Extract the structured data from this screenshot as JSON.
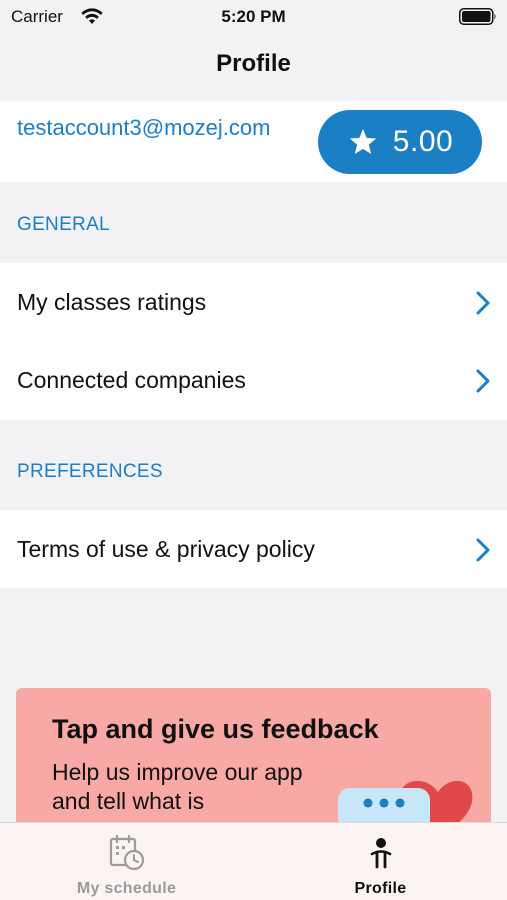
{
  "status_bar": {
    "carrier": "Carrier",
    "time": "5:20 PM"
  },
  "nav": {
    "title": "Profile"
  },
  "account": {
    "email": "testaccount3@mozej.com",
    "rating": "5.00"
  },
  "sections": {
    "general": {
      "header": "GENERAL",
      "items": [
        {
          "label": "My classes ratings"
        },
        {
          "label": "Connected companies"
        }
      ]
    },
    "preferences": {
      "header": "PREFERENCES",
      "items": [
        {
          "label": "Terms of use & privacy policy"
        }
      ]
    }
  },
  "feedback": {
    "title": "Tap and give us feedback",
    "text": "Help us improve our app and tell what is"
  },
  "tabs": [
    {
      "label": "My schedule",
      "icon": "calendar-clock-icon",
      "active": false
    },
    {
      "label": "Profile",
      "icon": "person-icon",
      "active": true
    }
  ],
  "colors": {
    "accent": "#1b7fc4",
    "background": "#f2f2f4",
    "feedback_card": "#f8a9a6",
    "tab_inactive": "#9b9b9b"
  }
}
